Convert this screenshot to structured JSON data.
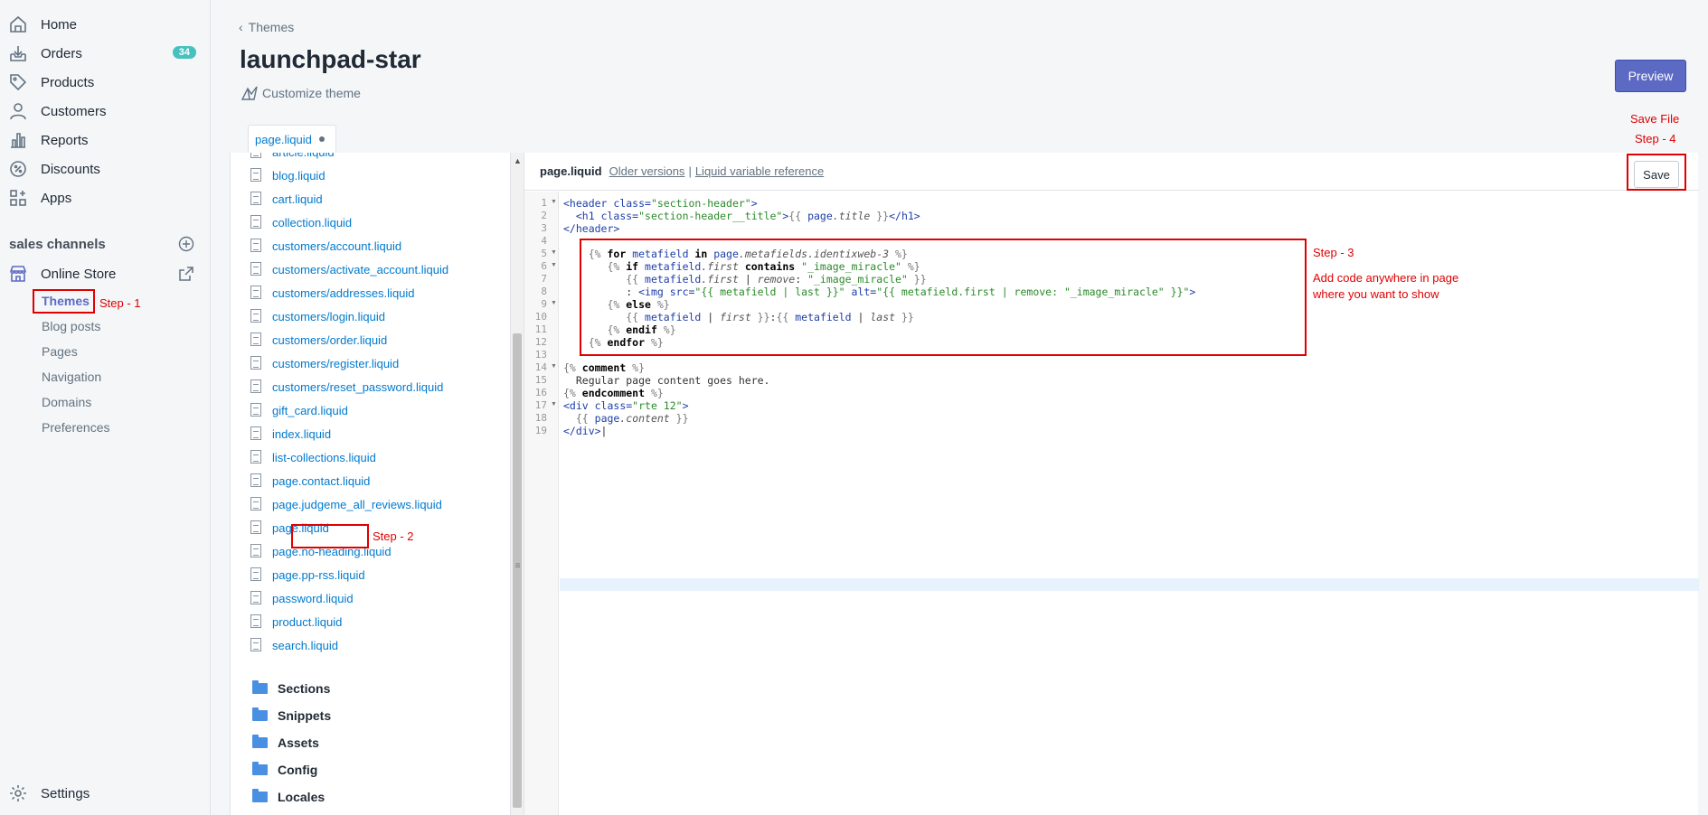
{
  "sidebar": {
    "items": [
      {
        "label": "Home",
        "icon": "home-icon"
      },
      {
        "label": "Orders",
        "icon": "orders-icon",
        "badge": "34"
      },
      {
        "label": "Products",
        "icon": "tag-icon"
      },
      {
        "label": "Customers",
        "icon": "person-icon"
      },
      {
        "label": "Reports",
        "icon": "bar-chart-icon"
      },
      {
        "label": "Discounts",
        "icon": "discount-icon"
      },
      {
        "label": "Apps",
        "icon": "apps-icon"
      }
    ],
    "sales_channels_title": "sales channels",
    "online_store": "Online Store",
    "sub_items": [
      "Themes",
      "Blog posts",
      "Pages",
      "Navigation",
      "Domains",
      "Preferences"
    ],
    "settings": "Settings"
  },
  "header": {
    "breadcrumb": "Themes",
    "title": "launchpad-star",
    "customize": "Customize theme",
    "preview": "Preview"
  },
  "tab": {
    "label": "page.liquid"
  },
  "files": [
    "article.liquid",
    "blog.liquid",
    "cart.liquid",
    "collection.liquid",
    "customers/account.liquid",
    "customers/activate_account.liquid",
    "customers/addresses.liquid",
    "customers/login.liquid",
    "customers/order.liquid",
    "customers/register.liquid",
    "customers/reset_password.liquid",
    "gift_card.liquid",
    "index.liquid",
    "list-collections.liquid",
    "page.contact.liquid",
    "page.judgeme_all_reviews.liquid",
    "page.liquid",
    "page.no-heading.liquid",
    "page.pp-rss.liquid",
    "password.liquid",
    "product.liquid",
    "search.liquid"
  ],
  "folders": [
    "Sections",
    "Snippets",
    "Assets",
    "Config",
    "Locales"
  ],
  "editor": {
    "filename": "page.liquid",
    "older_versions": "Older versions",
    "separator": "|",
    "liquid_ref": "Liquid variable reference",
    "save": "Save",
    "line_numbers": [
      "1",
      "2",
      "3",
      "4",
      "5",
      "6",
      "7",
      "8",
      "9",
      "10",
      "11",
      "12",
      "13",
      "14",
      "15",
      "16",
      "17",
      "18",
      "19"
    ]
  },
  "annotations": {
    "step1": "Step - 1",
    "step2": "Step - 2",
    "step3": "Step - 3",
    "step3_note_1": "Add code anywhere in page",
    "step3_note_2": "where you want to show",
    "save_file": "Save File",
    "step4": "Step - 4"
  },
  "colors": {
    "accent": "#5c6ac4",
    "link": "#007ace",
    "badge": "#47c1bf",
    "annotation_red": "#e00000"
  }
}
